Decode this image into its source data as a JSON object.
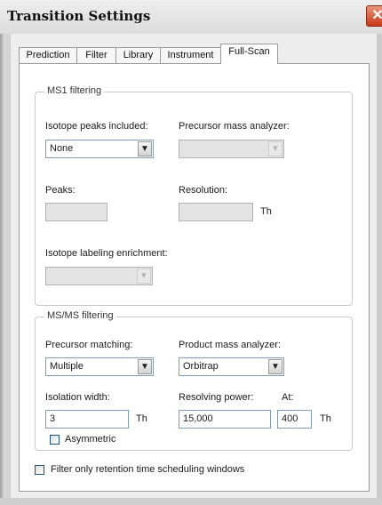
{
  "window": {
    "title": "Transition Settings",
    "close_glyph": "✕"
  },
  "tabs": [
    {
      "label": "Prediction"
    },
    {
      "label": "Filter"
    },
    {
      "label": "Library"
    },
    {
      "label": "Instrument"
    },
    {
      "label": "Full-Scan",
      "active": true
    }
  ],
  "ms1": {
    "group_label": "MS1 filtering",
    "isotope_peaks_label": "Isotope peaks included:",
    "isotope_peaks_value": "None",
    "precursor_analyzer_label": "Precursor mass analyzer:",
    "precursor_analyzer_value": "",
    "peaks_label": "Peaks:",
    "peaks_value": "",
    "resolution_label": "Resolution:",
    "resolution_value": "",
    "resolution_unit": "Th",
    "enrichment_label": "Isotope labeling enrichment:",
    "enrichment_value": ""
  },
  "msms": {
    "group_label": "MS/MS filtering",
    "precursor_matching_label": "Precursor matching:",
    "precursor_matching_value": "Multiple",
    "product_analyzer_label": "Product mass analyzer:",
    "product_analyzer_value": "Orbitrap",
    "isolation_width_label": "Isolation width:",
    "isolation_width_value": "3",
    "isolation_width_unit": "Th",
    "resolving_power_label": "Resolving power:",
    "resolving_power_value": "15,000",
    "at_label": "At:",
    "at_value": "400",
    "at_unit": "Th",
    "asymmetric_label": "Asymmetric",
    "asymmetric_checked": false
  },
  "retention_filter": {
    "label": "Filter only retention time scheduling windows",
    "checked": false
  },
  "icons": {
    "dropdown_arrow": "chevron-down-icon",
    "close": "close-icon"
  }
}
